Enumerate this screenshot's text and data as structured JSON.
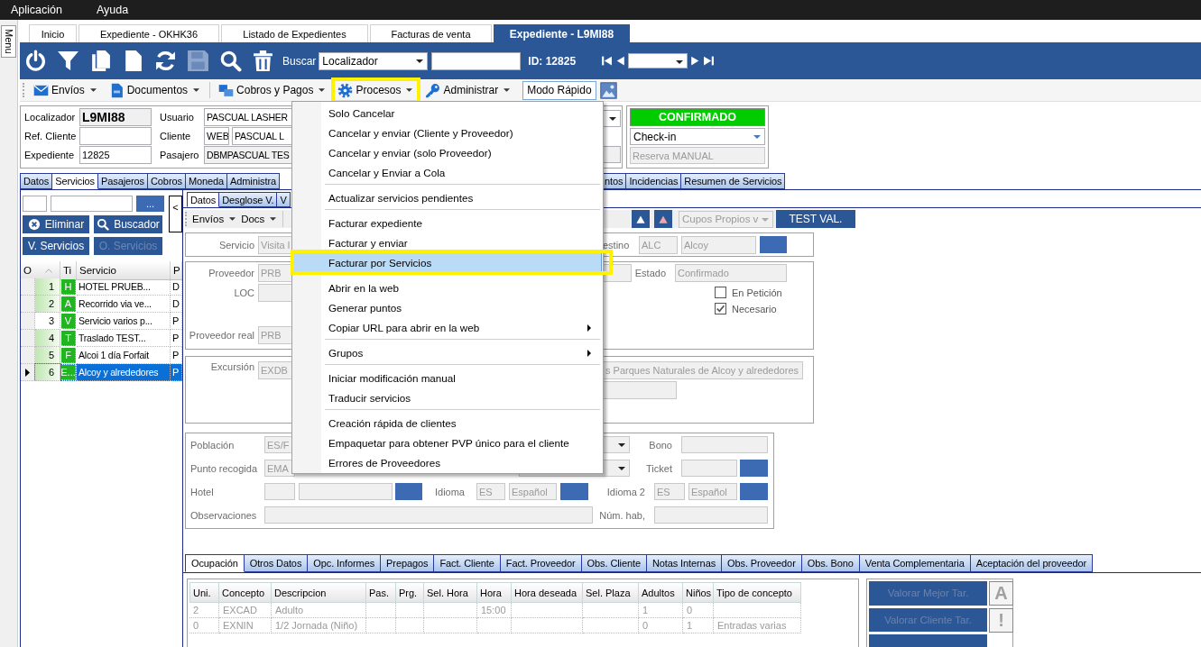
{
  "menubar": [
    {
      "label": "Aplicación"
    },
    {
      "label": "Ayuda"
    }
  ],
  "side_tab": {
    "label": "Menu"
  },
  "doc_tabs": [
    {
      "label": "Inicio",
      "selected": false
    },
    {
      "label": "Expediente  - OKHK36",
      "selected": false
    },
    {
      "label": "Listado de Expedientes",
      "selected": false
    },
    {
      "label": "Facturas de venta",
      "selected": false
    },
    {
      "label": "Expediente  - L9MI88",
      "selected": true
    }
  ],
  "tools": [
    {
      "kind": "power",
      "disabled": false
    },
    {
      "kind": "filter",
      "disabled": false
    },
    {
      "kind": "copy",
      "disabled": false
    },
    {
      "kind": "page",
      "disabled": false
    },
    {
      "kind": "refresh",
      "disabled": false
    },
    {
      "kind": "save",
      "disabled": true
    },
    {
      "kind": "search",
      "disabled": false
    },
    {
      "kind": "trash",
      "disabled": false
    }
  ],
  "search": {
    "label": "Buscar",
    "field": "Localizador",
    "id": "ID: 12825"
  },
  "toolbar": [
    {
      "kind": "menu",
      "label": "Envíos",
      "highlighted": false
    },
    {
      "kind": "menu",
      "label": "Documentos",
      "highlighted": false
    },
    {
      "kind": "separator"
    },
    {
      "kind": "menu",
      "label": "Cobros y Pagos",
      "highlighted": false
    },
    {
      "kind": "menu",
      "label": "Procesos",
      "highlighted": true
    },
    {
      "kind": "menu",
      "label": "Administrar",
      "highlighted": false
    },
    {
      "kind": "button",
      "label": "Modo Rápido"
    },
    {
      "kind": "image"
    }
  ],
  "header": {
    "localizador_label": "Localizador",
    "localizador": "L9MI88",
    "ref_label": "Ref. Cliente",
    "expediente_label": "Expediente",
    "expediente": "12825",
    "usuario_label": "Usuario",
    "usuario": "PASCUAL LASHER",
    "cliente_label": "Cliente",
    "cliente_code": "WEB",
    "cliente": "PASCUAL L",
    "pasajero_label": "Pasajero",
    "pasajero": "DBMPASCUAL TES"
  },
  "status": {
    "label": "CONFIRMADO",
    "checkin": "Check-in",
    "reserva": "Reserva MANUAL",
    "reserva_disabled": true
  },
  "main_tabs": [
    {
      "label": "Datos",
      "selected": false
    },
    {
      "label": "Servicios",
      "selected": true
    },
    {
      "label": "Pasajeros",
      "selected": false
    },
    {
      "label": "Cobros",
      "selected": false
    },
    {
      "label": "Moneda",
      "selected": false
    },
    {
      "label": "Administra",
      "selected": false
    }
  ],
  "main_tabs_right": [
    {
      "label": "ntos",
      "selected": false
    },
    {
      "label": "Incidencias",
      "selected": false
    },
    {
      "label": "Resumen de Servicios",
      "selected": false
    }
  ],
  "services": {
    "browse": "...",
    "collapse": "<",
    "buttons": [
      {
        "label": "Eliminar",
        "disabled": false
      },
      {
        "label": "Buscador",
        "disabled": false
      },
      {
        "label": "V. Servicios",
        "disabled": false
      },
      {
        "label": "O. Servicios",
        "disabled": true
      }
    ],
    "columns": [
      "O",
      "Ti",
      "Servicio",
      "P"
    ],
    "rows": [
      {
        "order": "1",
        "type": "H",
        "name": "HOTEL  PRUEB...",
        "col4": "D",
        "marked": true,
        "selected": false
      },
      {
        "order": "2",
        "type": "A",
        "name": "Recorrido via ve...",
        "col4": "D",
        "marked": true,
        "selected": false
      },
      {
        "order": "3",
        "type": "V",
        "name": "Servicio varios p...",
        "col4": "P",
        "marked": false,
        "selected": false
      },
      {
        "order": "4",
        "type": "T",
        "name": "Traslado TEST...",
        "col4": "P",
        "marked": true,
        "selected": false
      },
      {
        "order": "5",
        "type": "F",
        "name": "Alcoi 1 día Forfait",
        "col4": "P",
        "marked": true,
        "selected": false
      },
      {
        "order": "6",
        "type": "E...",
        "name": "Alcoy y alrededores",
        "col4": "P",
        "marked": true,
        "selected": true
      }
    ]
  },
  "detail": {
    "disabled": true,
    "tabs": [
      {
        "label": "Datos",
        "selected": true
      },
      {
        "label": "Desglose V.",
        "selected": false
      },
      {
        "label": "V",
        "selected": false
      }
    ],
    "toolbar": [
      {
        "label": "Envíos"
      },
      {
        "label": "Docs"
      }
    ],
    "cupos": "Cupos Propios v",
    "test_button": "TEST VAL.",
    "servicio": {
      "label": "Servicio",
      "value": "Visita l",
      "destino_label": "estino",
      "destino_code": "ALC",
      "destino": "Alcoy"
    },
    "proveedor": {
      "label": "Proveedor",
      "value": "PRB",
      "loc_label": "LOC",
      "real_label": "Proveedor real",
      "real_value": "PRB",
      "estado_label": "Estado",
      "estado": "Confirmado",
      "checks": [
        {
          "label": "En Petición",
          "checked": false
        },
        {
          "label": "Necesario",
          "checked": true
        }
      ]
    },
    "excursion": {
      "label": "Excursión",
      "code": "EXDB",
      "description": "s Parques Naturales de Alcoy y alrededores"
    },
    "location": {
      "poblacion_label": "Población",
      "poblacion": "ES/F",
      "bono_label": "Bono",
      "punto_label": "Punto recogida",
      "punto": "EMA",
      "ticket_label": "Ticket",
      "hotel_label": "Hotel",
      "idioma_label": "Idioma",
      "idioma_code": "ES",
      "idioma": "Español",
      "idioma2_label": "Idioma 2",
      "idioma2_code": "ES",
      "idioma2": "Español",
      "obs_label": "Observaciones",
      "hab_label": "Núm. hab,"
    }
  },
  "bottom_tabs": [
    {
      "label": "Ocupación",
      "selected": true
    },
    {
      "label": "Otros Datos",
      "selected": false
    },
    {
      "label": "Opc. Informes",
      "selected": false
    },
    {
      "label": "Prepagos",
      "selected": false
    },
    {
      "label": "Fact. Cliente",
      "selected": false
    },
    {
      "label": "Fact. Proveedor",
      "selected": false
    },
    {
      "label": "Obs. Cliente",
      "selected": false
    },
    {
      "label": "Notas Internas",
      "selected": false
    },
    {
      "label": "Obs. Proveedor",
      "selected": false
    },
    {
      "label": "Obs. Bono",
      "selected": false
    },
    {
      "label": "Venta Complementaria",
      "selected": false
    },
    {
      "label": "Aceptación del proveedor",
      "selected": false
    }
  ],
  "occupancy": {
    "columns": [
      "Uni.",
      "Concepto",
      "Descripcion",
      "Pas.",
      "Prg.",
      "Sel. Hora",
      "Hora",
      "Hora deseada",
      "Sel. Plaza",
      "Adultos",
      "Niños",
      "Tipo de concepto"
    ],
    "rows": [
      [
        "2",
        "EXCAD",
        "Adulto",
        null,
        null,
        null,
        "15:00",
        null,
        null,
        "1",
        "0",
        null
      ],
      [
        "0",
        "EXNIN",
        "1/2 Jornada (Niño)",
        null,
        null,
        null,
        null,
        null,
        null,
        "0",
        "1",
        "Entradas varias"
      ]
    ]
  },
  "valuation": {
    "buttons": [
      {
        "label": "Valorar Mejor Tar."
      },
      {
        "label": "Valorar Cliente Tar."
      }
    ],
    "side_buttons": [
      {
        "label": "A"
      },
      {
        "label": "!"
      }
    ]
  },
  "menu": {
    "items": [
      {
        "kind": "item",
        "label": "Solo Cancelar",
        "submenu": false,
        "selected": false,
        "highlighted": false
      },
      {
        "kind": "item",
        "label": "Cancelar y enviar (Cliente y Proveedor)",
        "submenu": false,
        "selected": false,
        "highlighted": false
      },
      {
        "kind": "item",
        "label": "Cancelar y enviar (solo Proveedor)",
        "submenu": false,
        "selected": false,
        "highlighted": false
      },
      {
        "kind": "item",
        "label": "Cancelar y Enviar a Cola",
        "submenu": false,
        "selected": false,
        "highlighted": false
      },
      {
        "kind": "separator"
      },
      {
        "kind": "item",
        "label": "Actualizar servicios pendientes",
        "submenu": false,
        "selected": false,
        "highlighted": false
      },
      {
        "kind": "separator"
      },
      {
        "kind": "item",
        "label": "Facturar expediente",
        "submenu": false,
        "selected": false,
        "highlighted": false
      },
      {
        "kind": "item",
        "label": "Facturar y enviar",
        "submenu": false,
        "selected": false,
        "highlighted": false
      },
      {
        "kind": "item",
        "label": "Facturar por Servicios",
        "submenu": false,
        "selected": true,
        "highlighted": true
      },
      {
        "kind": "separator"
      },
      {
        "kind": "item",
        "label": "Abrir en la web",
        "submenu": false,
        "selected": false,
        "highlighted": false
      },
      {
        "kind": "item",
        "label": "Generar puntos",
        "submenu": false,
        "selected": false,
        "highlighted": false
      },
      {
        "kind": "item",
        "label": "Copiar URL para abrir en la web",
        "submenu": true,
        "selected": false,
        "highlighted": false
      },
      {
        "kind": "separator"
      },
      {
        "kind": "item",
        "label": "Grupos",
        "submenu": true,
        "selected": false,
        "highlighted": false
      },
      {
        "kind": "separator"
      },
      {
        "kind": "item",
        "label": "Iniciar modificación manual",
        "submenu": false,
        "selected": false,
        "highlighted": false
      },
      {
        "kind": "item",
        "label": "Traducir servicios",
        "submenu": false,
        "selected": false,
        "highlighted": false
      },
      {
        "kind": "separator"
      },
      {
        "kind": "item",
        "label": "Creación rápida de clientes",
        "submenu": false,
        "selected": false,
        "highlighted": false
      },
      {
        "kind": "item",
        "label": "Empaquetar para obtener PVP único para el cliente",
        "submenu": false,
        "selected": false,
        "highlighted": false
      },
      {
        "kind": "item",
        "label": "Errores de Proveedores",
        "submenu": false,
        "selected": false,
        "highlighted": false
      }
    ]
  }
}
